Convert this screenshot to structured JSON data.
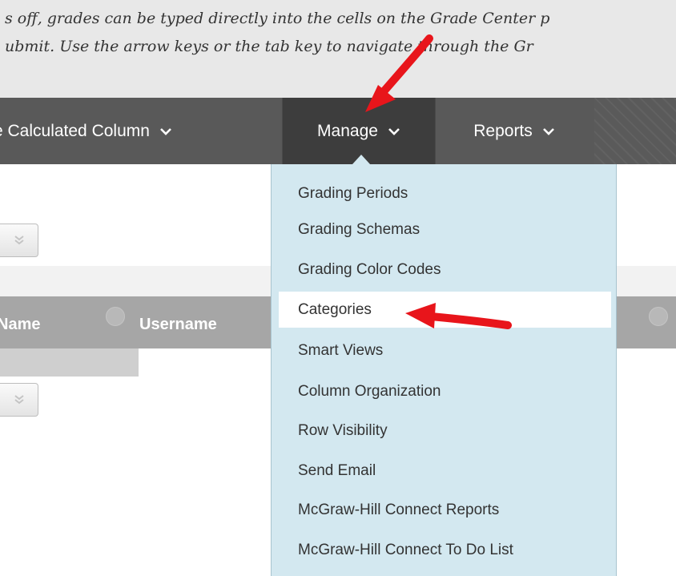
{
  "instructions": {
    "line1": "s off, grades can be typed directly into the cells on the Grade Center p",
    "line2": "ubmit. Use the arrow keys or the tab key to navigate through the Gr"
  },
  "toolbar": {
    "calculated_column_label": "e Calculated Column",
    "manage_label": "Manage",
    "reports_label": "Reports"
  },
  "grid": {
    "columns": [
      {
        "label": "Name"
      },
      {
        "label": "Username"
      }
    ]
  },
  "manage_menu": {
    "items": [
      {
        "label": "Grading Periods"
      },
      {
        "label": "Grading Schemas"
      },
      {
        "label": "Grading Color Codes"
      },
      {
        "label": "Categories",
        "highlighted": true
      },
      {
        "label": "Smart Views"
      },
      {
        "label": "Column Organization"
      },
      {
        "label": "Row Visibility"
      },
      {
        "label": "Send Email"
      },
      {
        "label": "McGraw-Hill Connect Reports"
      },
      {
        "label": "McGraw-Hill Connect To Do List"
      }
    ]
  },
  "colors": {
    "toolbar": "#595959",
    "toolbar_active": "#3d3d3d",
    "menu_background": "#d3e8f0",
    "annotation_arrow": "#e8151b"
  },
  "icons": [
    "chevron-down-icon",
    "double-chevron-down-icon",
    "column-options-icon",
    "red-arrow-annotation"
  ]
}
